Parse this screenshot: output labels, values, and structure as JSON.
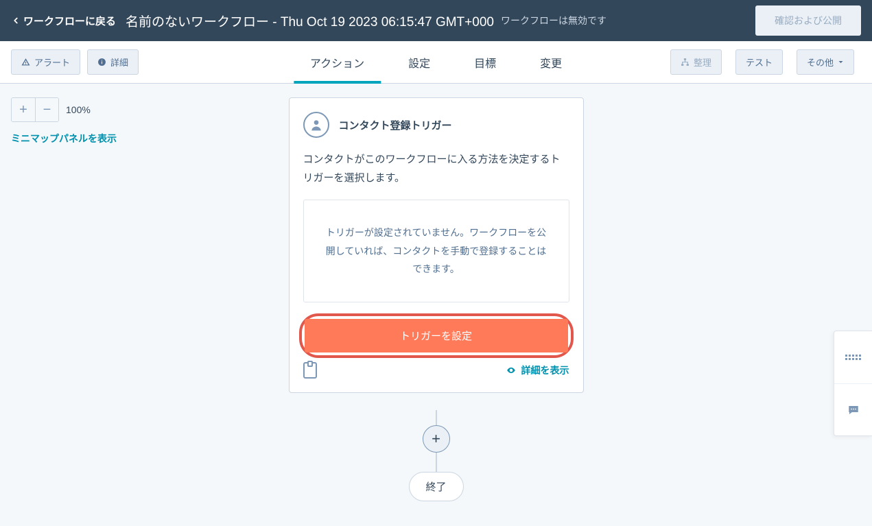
{
  "header": {
    "back_label": "ワークフローに戻る",
    "title": "名前のないワークフロー - Thu Oct 19 2023 06:15:47 GMT+000",
    "status": "ワークフローは無効です",
    "publish_label": "確認および公開"
  },
  "toolbar": {
    "alert_label": "アラート",
    "detail_label": "詳細",
    "organize_label": "整理",
    "test_label": "テスト",
    "more_label": "その他",
    "tabs": {
      "action": "アクション",
      "settings": "設定",
      "goal": "目標",
      "change": "変更"
    }
  },
  "canvas": {
    "zoom_level": "100%",
    "minimap_label": "ミニマップパネルを表示",
    "plus": "+",
    "end_label": "終了"
  },
  "trigger_card": {
    "title": "コンタクト登録トリガー",
    "description": "コンタクトがこのワークフローに入る方法を決定するトリガーを選択します。",
    "empty_message": "トリガーが設定されていません。ワークフローを公開していれば、コンタクトを手動で登録することはできます。",
    "setup_button": "トリガーを設定",
    "details_link": "詳細を表示"
  }
}
